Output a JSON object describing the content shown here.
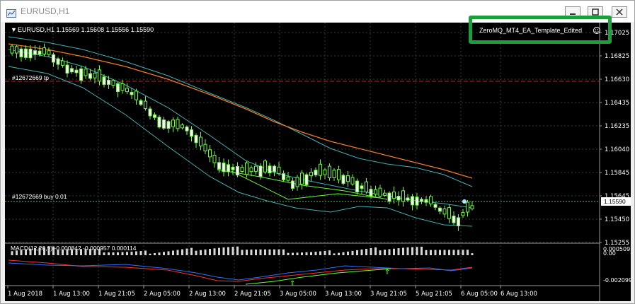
{
  "window": {
    "title": "EURUSD,H1"
  },
  "chart": {
    "header": "EURUSD,H1  1.15569 1.15608 1.15556 1.15590",
    "ea_label": "ZeroMQ_MT4_EA_Template_Edited",
    "order_tp_label": "#12672669 tp",
    "order_buy_label": "#12672669 buy 0.01",
    "current_price": "1.15590",
    "price_ticks": [
      "1.17025",
      "1.16825",
      "1.16630",
      "1.16435",
      "1.16235",
      "1.16040",
      "1.15845",
      "1.15645",
      "1.15450",
      "1.15255"
    ],
    "macd_label": "MACD(12,26,9) -0.000842 -0.000957 0.000114",
    "macd_ticks": [
      "0.000509",
      "0.00",
      "-0.002099"
    ],
    "time_ticks": [
      "1 Aug 2018",
      "1 Aug 13:00",
      "1 Aug 21:05",
      "2 Aug 05:00",
      "2 Aug 13:00",
      "2 Aug 21:05",
      "3 Aug 05:00",
      "3 Aug 13:00",
      "3 Aug 21:05",
      "5 Aug 21:05",
      "6 Aug 05:00",
      "6 Aug 13:00"
    ]
  },
  "colors": {
    "background": "#000000",
    "grid": "#3a3a3a",
    "candle": "#66ff33",
    "bollinger": "#40b0b0",
    "moving_average": "#f07a20",
    "tp_line": "#d02020",
    "buy_line": "#60c060",
    "macd_main": "#ff3030",
    "macd_signal": "#3070ff",
    "highlight": "#1f9d3c"
  }
}
